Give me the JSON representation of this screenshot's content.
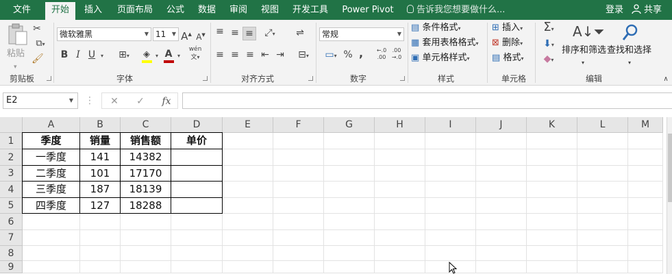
{
  "tabs": [
    "文件",
    "开始",
    "插入",
    "页面布局",
    "公式",
    "数据",
    "审阅",
    "视图",
    "开发工具",
    "Power Pivot"
  ],
  "active_tab": "开始",
  "tell_me": "告诉我您想要做什么...",
  "login": "登录",
  "share": "共享",
  "clipboard": {
    "paste": "粘贴",
    "label": "剪贴板"
  },
  "font": {
    "name": "微软雅黑",
    "size": "11",
    "bold": "B",
    "italic": "I",
    "underline": "U",
    "grow": "A",
    "shrink": "A",
    "wen": "wén",
    "label": "字体"
  },
  "alignment": {
    "label": "对齐方式"
  },
  "number": {
    "format": "常规",
    "percent": "%",
    "comma": ",",
    "inc": "←.0",
    "dec": ".00",
    "label": "数字"
  },
  "styles": {
    "conditional": "条件格式",
    "table": "套用表格格式",
    "cell": "单元格样式",
    "label": "样式"
  },
  "cells": {
    "insert": "插入",
    "delete": "删除",
    "format": "格式",
    "label": "单元格"
  },
  "editing": {
    "sum": "Σ",
    "sort": "排序和筛选",
    "find": "查找和选择",
    "label": "编辑"
  },
  "formula_bar": {
    "name_box": "E2",
    "cancel": "✕",
    "enter": "✓",
    "fx": "fx",
    "value": ""
  },
  "columns": [
    "A",
    "B",
    "C",
    "D",
    "E",
    "F",
    "G",
    "H",
    "I",
    "J",
    "K",
    "L",
    "M"
  ],
  "rows": [
    "1",
    "2",
    "3",
    "4",
    "5",
    "6",
    "7",
    "8",
    "9"
  ],
  "table": {
    "headers": [
      "季度",
      "销量",
      "销售额",
      "单价"
    ],
    "body": [
      [
        "一季度",
        "141",
        "14382",
        ""
      ],
      [
        "二季度",
        "101",
        "17170",
        ""
      ],
      [
        "三季度",
        "187",
        "18139",
        ""
      ],
      [
        "四季度",
        "127",
        "18288",
        ""
      ]
    ]
  },
  "colors": {
    "accent": "#217346",
    "fill_yellow": "#ffff00",
    "font_red": "#c00000"
  }
}
